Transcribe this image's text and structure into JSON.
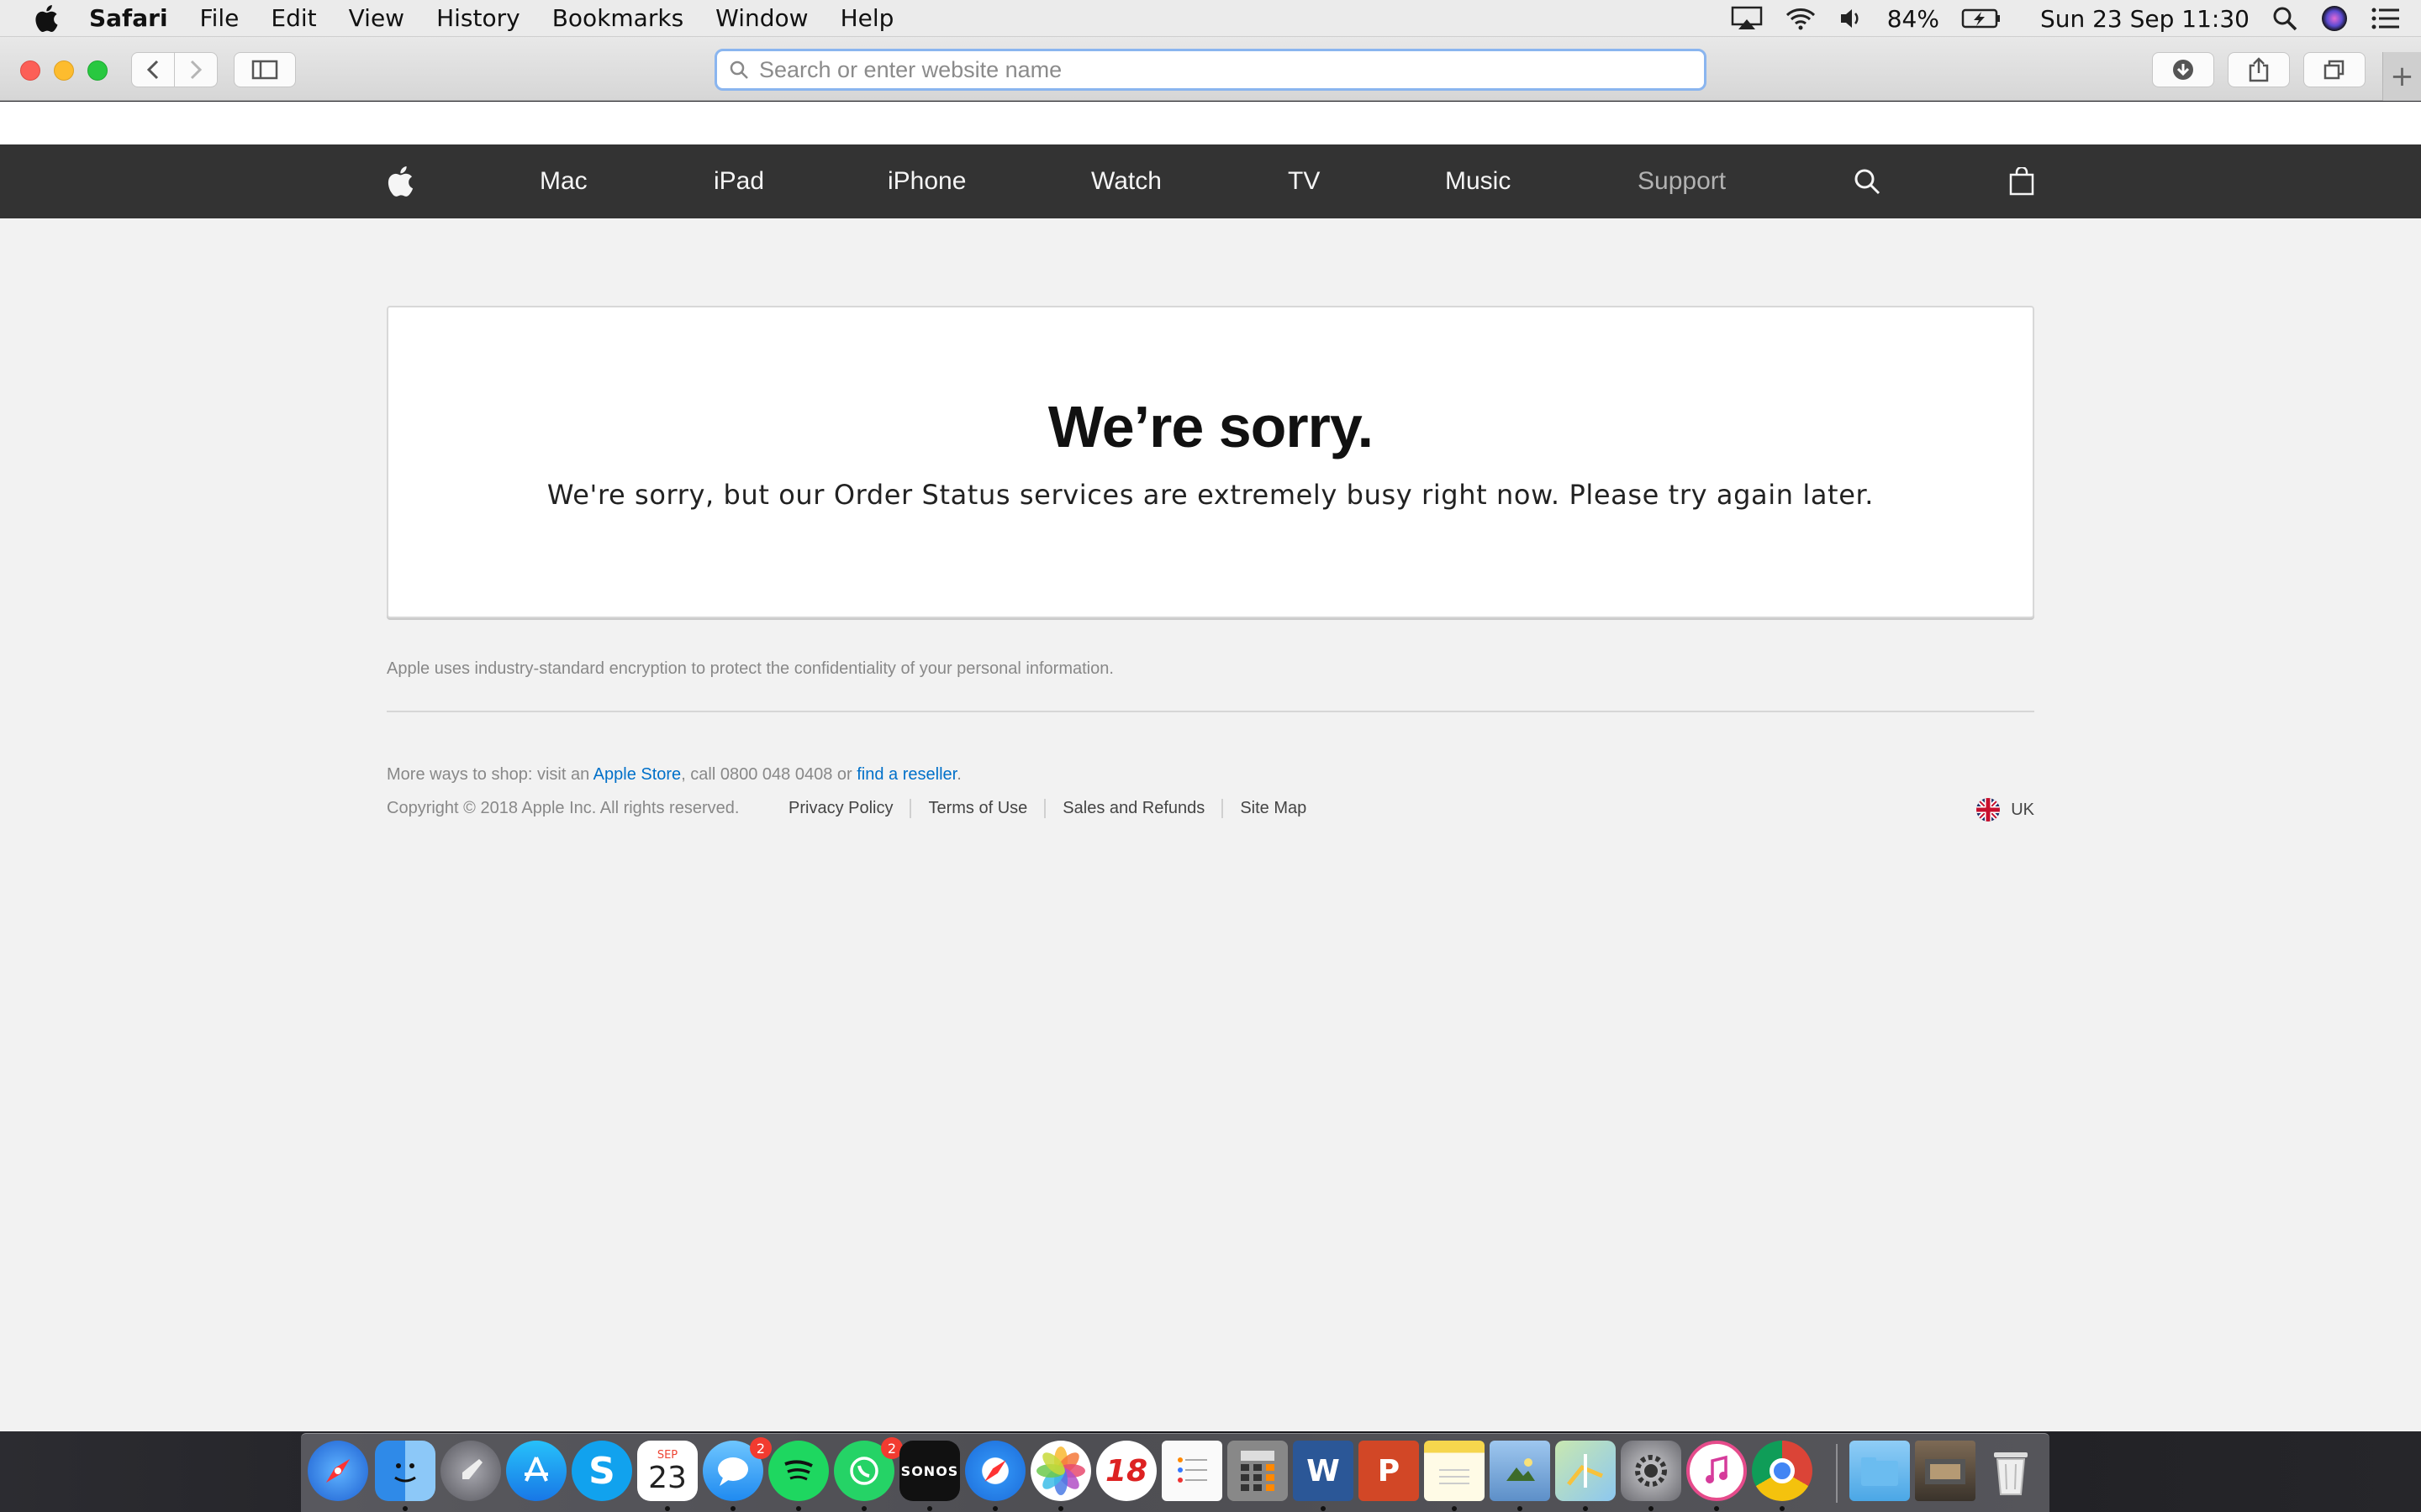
{
  "menubar": {
    "app_name": "Safari",
    "items": [
      "File",
      "Edit",
      "View",
      "History",
      "Bookmarks",
      "Window",
      "Help"
    ],
    "battery": "84%",
    "clock": "Sun 23 Sep  11:30"
  },
  "safari": {
    "address_placeholder": "Search or enter website name",
    "new_tab_label": "+"
  },
  "globalnav": {
    "items": [
      "Mac",
      "iPad",
      "iPhone",
      "Watch",
      "TV",
      "Music",
      "Support"
    ]
  },
  "error": {
    "title": "We’re sorry.",
    "message": "We're sorry, but our Order Status services are extremely busy right now. Please try again later."
  },
  "footer": {
    "secure_note": "Apple uses industry-standard encryption to protect the confidentiality of your personal information.",
    "more_ways_prefix": "More ways to shop: visit an ",
    "apple_store_link": "Apple Store",
    "more_ways_middle": ", call 0800 048 0408 or ",
    "reseller_link": "find a reseller",
    "more_ways_suffix": ".",
    "copyright": "Copyright © 2018 Apple Inc. All rights reserved.",
    "links": [
      "Privacy Policy",
      "Terms of Use",
      "Sales and Refunds",
      "Site Map"
    ],
    "locale": "UK"
  },
  "dock": {
    "calendar_month": "SEP",
    "calendar_day": "23",
    "messages_badge": "2",
    "whatsapp_badge": "2",
    "sonos_label": "SONOS",
    "fantastical_label": "18",
    "word_label": "W",
    "powerpoint_label": "P",
    "skype_label": "S"
  },
  "colors": {
    "nav_background": "#333333",
    "page_background": "#f2f2f2",
    "link_blue": "#0070c9",
    "address_focus": "#8ab5ef"
  }
}
